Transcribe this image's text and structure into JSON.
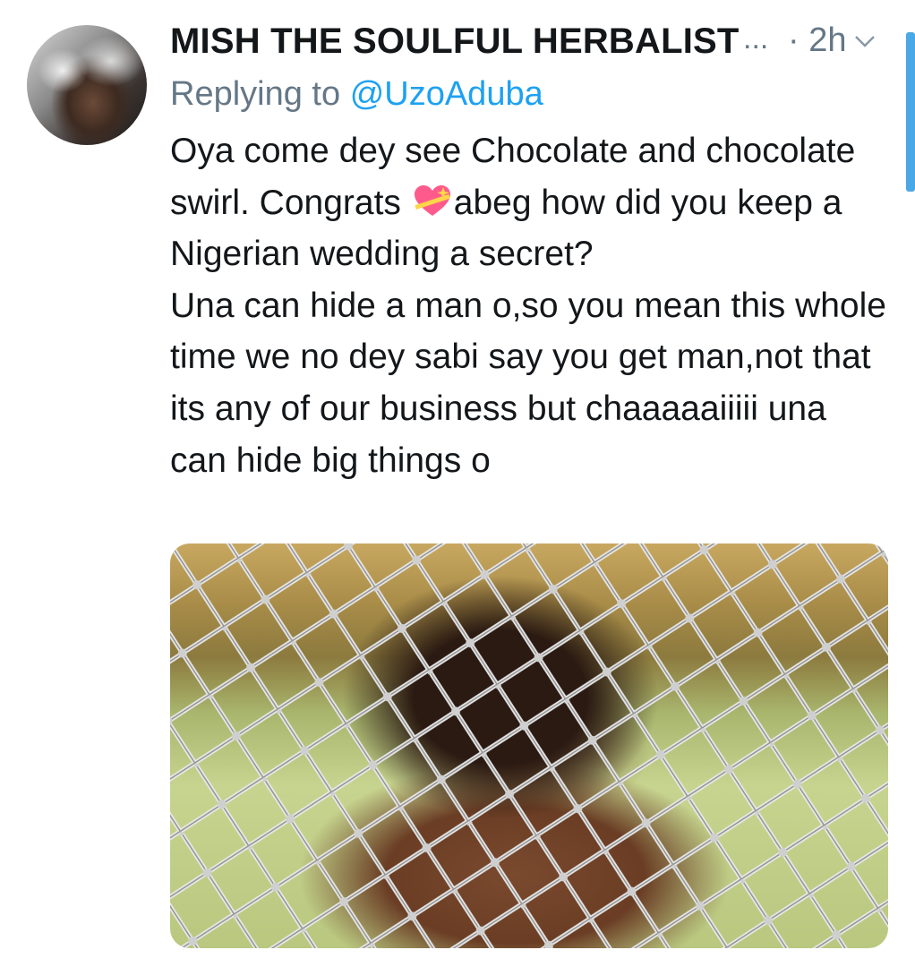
{
  "tweet": {
    "display_name": "MISH THE SOULFUL HERBALIST",
    "name_truncation": "...",
    "timestamp_separator": "·",
    "timestamp": "2h",
    "reply_prefix": "Replying to",
    "reply_handle": "@UzoAduba",
    "text_line_1a": "Oya come dey see Chocolate and",
    "text_line_1b": "chocolate swirl. Congrats",
    "text_emoji": "sparkling-heart-emoji",
    "text_line_1c": "abeg how did you keep a Nigerian wedding a secret?",
    "text_paragraph_2": "Una can hide a man o,so you mean this whole time we no dey sabi say you get man,not that its any of our business but chaaaaaiiiii una can hide big things o"
  },
  "icons": {
    "avatar": "avatar-image",
    "chevron": "chevron-down-icon",
    "media": "fence-gif-image"
  },
  "colors": {
    "name": "#14171a",
    "secondary": "#657786",
    "link": "#1da1f2",
    "scrollbar": "#4aa8e6"
  }
}
